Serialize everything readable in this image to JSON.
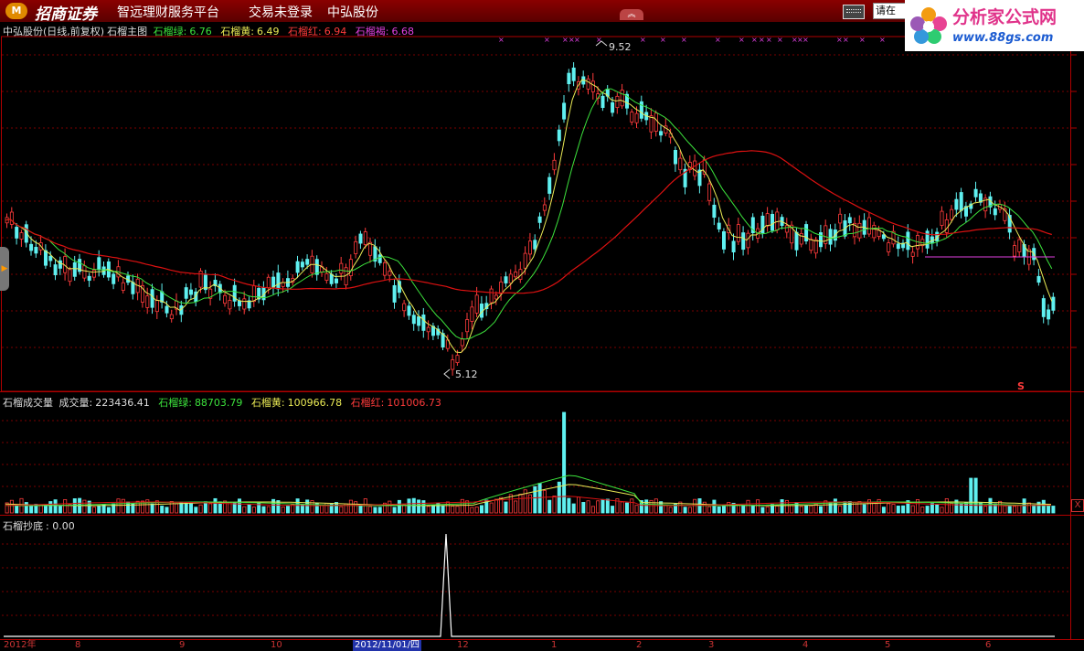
{
  "window": {
    "brand": "招商证券",
    "menu": [
      "智远理财服务平台",
      "交易未登录",
      "中弘股份"
    ],
    "search_placeholder": "请在",
    "site_name": "分析家公式网",
    "site_url": "www.88gs.com"
  },
  "main_panel": {
    "stock": "中弘股份(日线,前复权)",
    "indicator": "石榴主图",
    "items": [
      {
        "label": "石榴绿:",
        "value": "6.76",
        "color": "#3ce23c"
      },
      {
        "label": "石榴黄:",
        "value": "6.49",
        "color": "#eaea55"
      },
      {
        "label": "石榴红:",
        "value": "6.94",
        "color": "#ff3b3b"
      },
      {
        "label": "石榴褐:",
        "value": "6.68",
        "color": "#e040e0"
      }
    ],
    "high_label": "9.52",
    "low_label": "5.12",
    "signal_mark": "S"
  },
  "volume_panel": {
    "indicator": "石榴成交量",
    "items": [
      {
        "label": "成交量:",
        "value": "223436.41",
        "color": "#dddddd"
      },
      {
        "label": "石榴绿:",
        "value": "88703.79",
        "color": "#3ce23c"
      },
      {
        "label": "石榴黄:",
        "value": "100966.78",
        "color": "#eaea55"
      },
      {
        "label": "石榴红:",
        "value": "101006.73",
        "color": "#ff3b3b"
      }
    ]
  },
  "bottom_panel": {
    "indicator": "石榴抄底",
    "value": ": 0.00"
  },
  "date_axis": {
    "labels": [
      "2012年",
      "8",
      "9",
      "10",
      "12",
      "1",
      "2",
      "3",
      "4",
      "5",
      "6"
    ],
    "selected": "2012/11/01/四"
  },
  "colors": {
    "up": "#ff3b3b",
    "down": "#5ff0f0",
    "grid": "#7a0000",
    "frame": "#b00000"
  }
}
